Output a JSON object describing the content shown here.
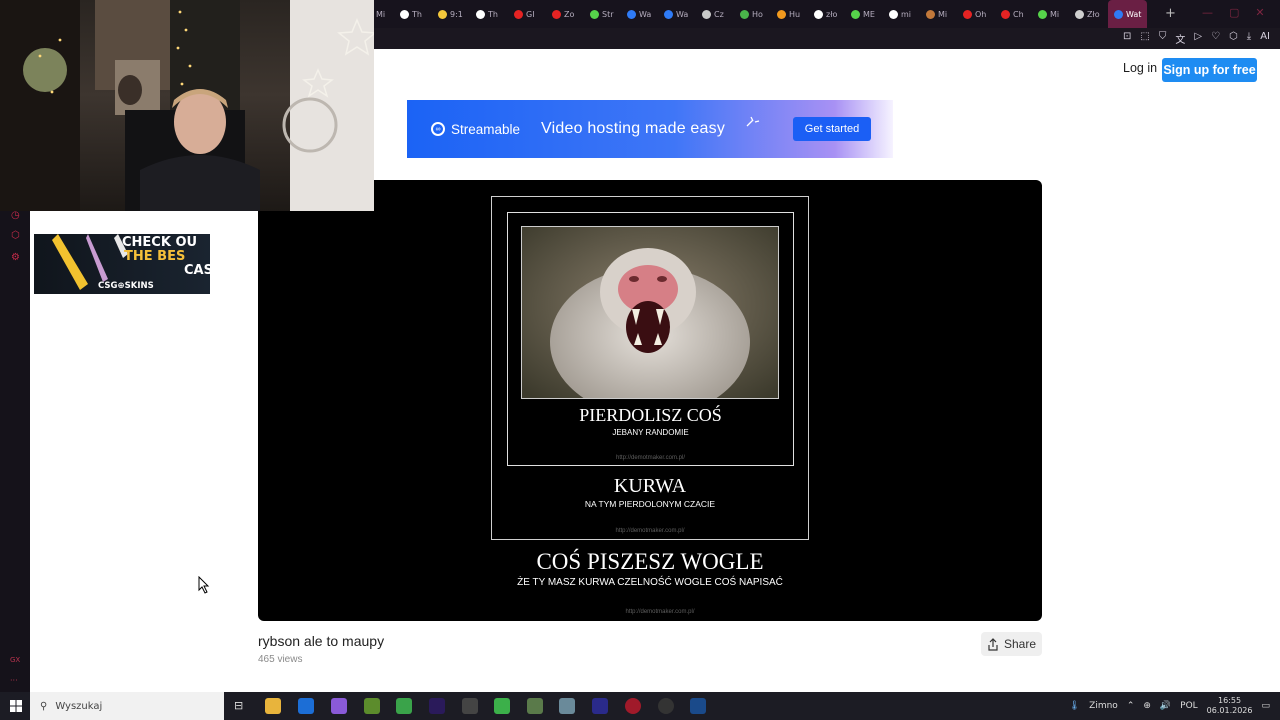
{
  "browser": {
    "tabs": [
      {
        "label": "Mi"
      },
      {
        "label": "Th",
        "favicon_color": "#ffffff"
      },
      {
        "label": "9:1",
        "favicon_color": "#f3c73b"
      },
      {
        "label": "Th",
        "favicon_color": "#ffffff"
      },
      {
        "label": "GI",
        "favicon_color": "#e52323"
      },
      {
        "label": "Zo",
        "favicon_color": "#e52323"
      },
      {
        "label": "Str",
        "favicon_color": "#56d34a"
      },
      {
        "label": "Wa",
        "favicon_color": "#2f7bf6"
      },
      {
        "label": "Wa",
        "favicon_color": "#2f7bf6"
      },
      {
        "label": "Cz",
        "favicon_color": "#c9c9c9"
      },
      {
        "label": "Ho",
        "favicon_color": "#4ab54a"
      },
      {
        "label": "Hu",
        "favicon_color": "#f29a1e"
      },
      {
        "label": "zło",
        "favicon_color": "#ffffff"
      },
      {
        "label": "ME",
        "favicon_color": "#56d34a"
      },
      {
        "label": "mi",
        "favicon_color": "#ffffff"
      },
      {
        "label": "Mi",
        "favicon_color": "#c2783a"
      },
      {
        "label": "Oh",
        "favicon_color": "#e52323"
      },
      {
        "label": "Ch",
        "favicon_color": "#e52323"
      },
      {
        "label": "Mi",
        "favicon_color": "#56d34a"
      },
      {
        "label": "Zło",
        "favicon_color": "#cfcfcf"
      },
      {
        "label": "Wat",
        "favicon_color": "#2f7bf6",
        "active": true
      }
    ],
    "new_tab": "+",
    "window_controls": [
      "—",
      "▢",
      "✕"
    ],
    "toolbar_ai": "AI"
  },
  "header": {
    "login": "Log in",
    "signup": "Sign up for free"
  },
  "banner": {
    "logo": "Streamable",
    "tagline": "Video hosting made easy",
    "cta": "Get started"
  },
  "video": {
    "demotivator": {
      "panel1_title": "PIERDOLISZ COŚ",
      "panel1_sub": "JEBANY RANDOMIE",
      "panel1_url": "http://demotmaker.com.pl/",
      "panel2_title": "KURWA",
      "panel2_sub": "NA TYM PIERDOLONYM CZACIE",
      "panel2_url": "http://demotmaker.com.pl/",
      "panel3_title": "COŚ PISZESZ WOGLE",
      "panel3_sub": "ŻE TY MASZ KURWA CZELNOŚĆ WOGLE COŚ NAPISAĆ",
      "panel3_url": "http://demotmaker.com.pl/"
    },
    "title": "rybson ale to maupy",
    "views": "465 views",
    "share": "Share"
  },
  "ad": {
    "line1": "CHECK OU",
    "line2": "THE BES",
    "line3": "CASE",
    "brand": "CSG⊕SKINS"
  },
  "sidebar": {
    "bottom_label": "GX",
    "more": "···"
  },
  "taskbar": {
    "search_placeholder": "Wyszukaj",
    "weather": "Zimno",
    "language": "POL",
    "time": "16:55",
    "date": "06.01.2026"
  }
}
